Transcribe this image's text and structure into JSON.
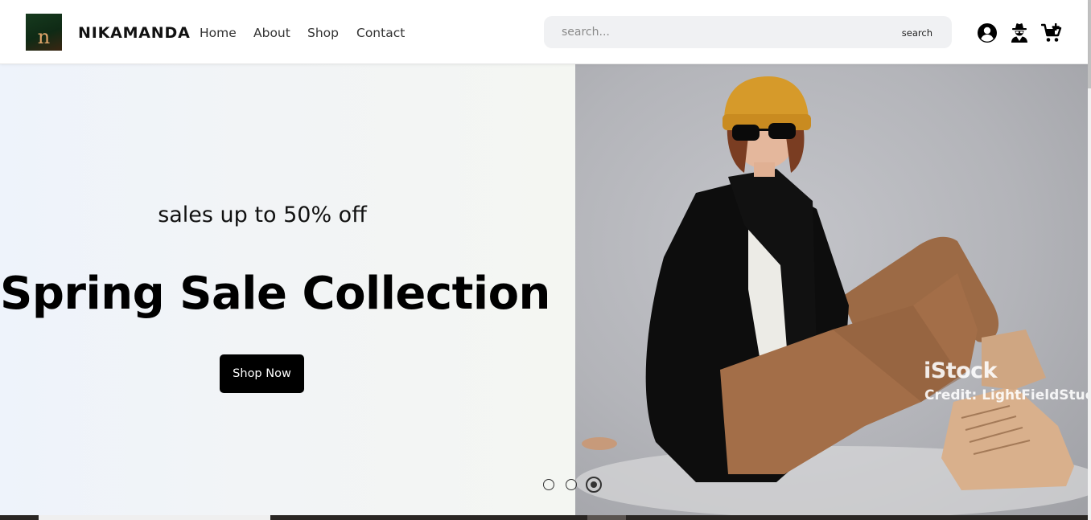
{
  "header": {
    "logo_letter": "n",
    "brand": "NIKAMANDA",
    "nav": [
      {
        "label": "Home"
      },
      {
        "label": "About"
      },
      {
        "label": "Shop"
      },
      {
        "label": "Contact"
      }
    ],
    "search": {
      "placeholder": "search...",
      "button_label": "search"
    },
    "icons": [
      "user-circle-icon",
      "user-secret-icon",
      "cart-plus-icon"
    ]
  },
  "hero": {
    "subtitle": "sales up to 50% off",
    "title": "Spring Sale Collection",
    "cta_label": "Shop Now",
    "image_watermark": {
      "brand": "iStock",
      "credit": "Credit: LightFieldStuc"
    },
    "carousel": {
      "slide_count": 3,
      "active_index": 2
    }
  },
  "colors": {
    "cta_background": "#000000",
    "search_background": "#f0f1f3",
    "logo_background": "#163a1e",
    "logo_letter": "#e0a56a"
  }
}
